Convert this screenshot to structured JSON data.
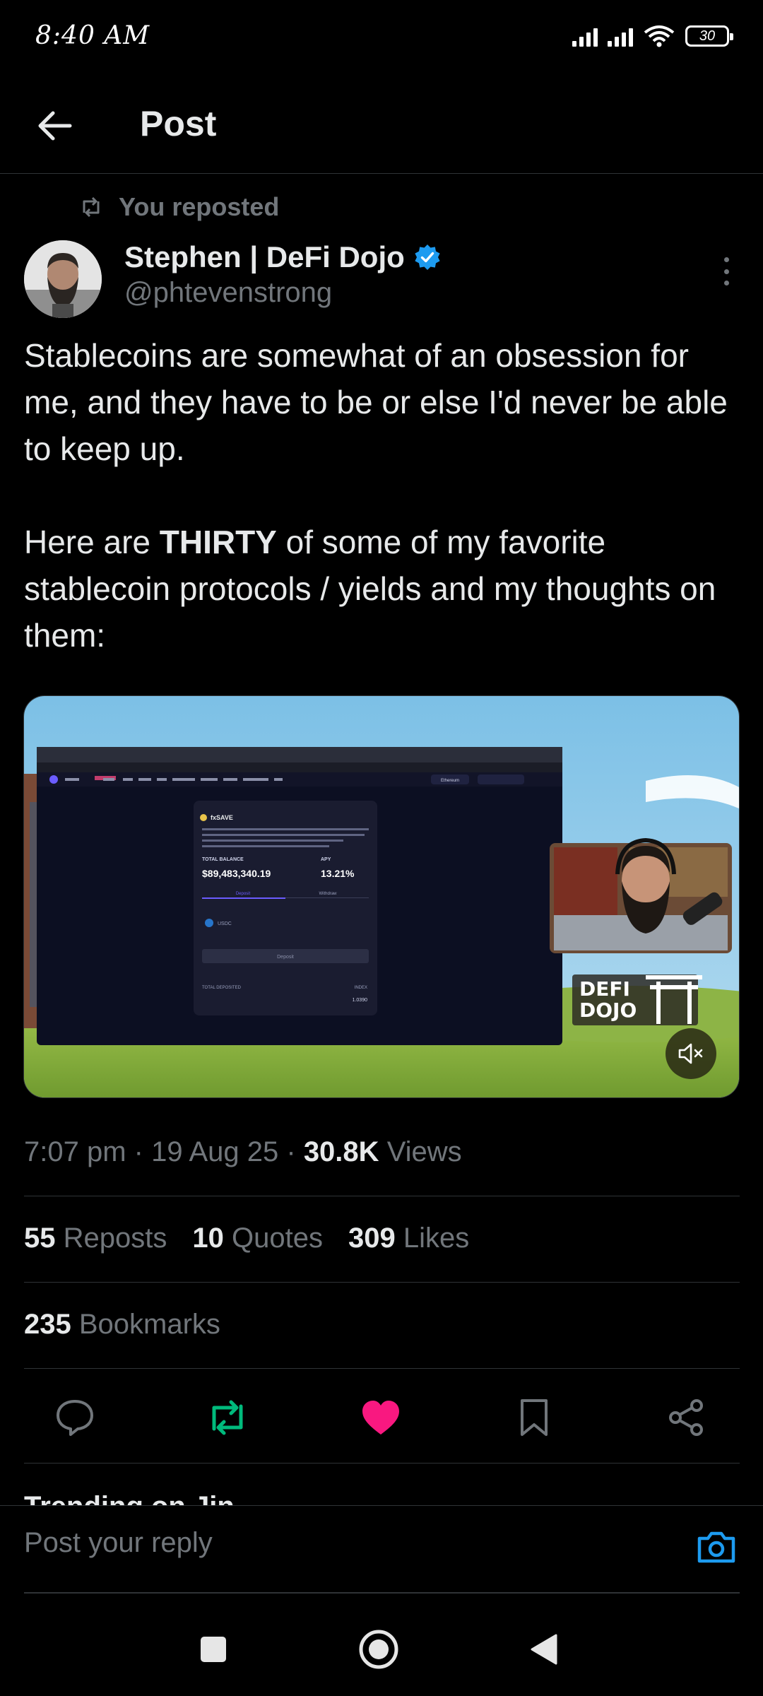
{
  "status_bar": {
    "time": "8:40 AM",
    "battery": "30"
  },
  "header": {
    "title": "Post"
  },
  "repost": {
    "label": "You reposted"
  },
  "author": {
    "name": "Stephen | DeFi Dojo",
    "handle": "@phtevenstrong",
    "verified": true,
    "verified_color": "#1d9bf0"
  },
  "post": {
    "paragraph1": "Stablecoins are somewhat of an obsession for me, and they have to be or else I'd never be able to keep up.",
    "paragraph2_before": "Here are ",
    "paragraph2_bold": "THIRTY",
    "paragraph2_after": " of some of my favorite stablecoin protocols / yields and my thoughts on them:"
  },
  "media": {
    "card_title": "fxSAVE",
    "total_balance_label": "TOTAL BALANCE",
    "total_balance": "$89,483,340.19",
    "apy_label": "APY",
    "apy": "13.21%",
    "deposit_tab": "Deposit",
    "withdraw_tab": "Withdraw",
    "token": "USDC",
    "deposit_button": "Deposit",
    "total_deposited_label": "TOTAL DEPOSITED",
    "index_label": "INDEX",
    "index_value": "1.0390",
    "network": "Ethereum",
    "logo_line1": "DEFI",
    "logo_line2": "DOJO"
  },
  "meta": {
    "time": "7:07 pm",
    "date": "19 Aug 25",
    "views_count": "30.8K",
    "views_label": "Views"
  },
  "stats": {
    "reposts_count": "55",
    "reposts_label": "Reposts",
    "quotes_count": "10",
    "quotes_label": "Quotes",
    "likes_count": "309",
    "likes_label": "Likes",
    "bookmarks_count": "235",
    "bookmarks_label": "Bookmarks"
  },
  "actions": {
    "reply_icon": "reply-icon",
    "repost_icon": "repost-icon",
    "like_icon": "heart-icon",
    "bookmark_icon": "bookmark-icon",
    "share_icon": "share-icon",
    "repost_color": "#00ba7c",
    "like_color": "#f91880"
  },
  "trending": {
    "label": "Trending on Jin"
  },
  "reply": {
    "placeholder": "Post your reply",
    "accent": "#1d9bf0"
  }
}
